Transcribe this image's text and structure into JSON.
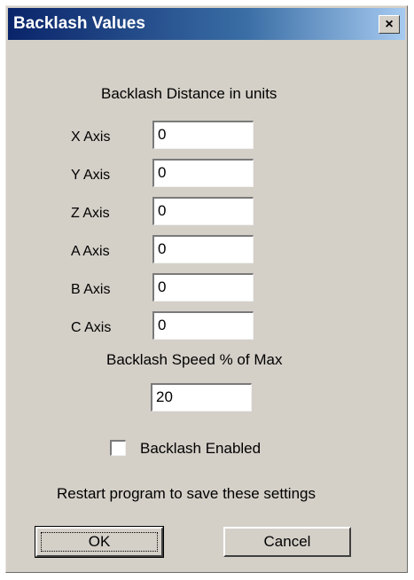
{
  "window": {
    "title": "Backlash Values",
    "close_label": "×"
  },
  "distance_heading": "Backlash Distance in units",
  "axes": [
    {
      "label": "X Axis",
      "value": "0"
    },
    {
      "label": "Y Axis",
      "value": "0"
    },
    {
      "label": "Z Axis",
      "value": "0"
    },
    {
      "label": "A Axis",
      "value": "0"
    },
    {
      "label": "B Axis",
      "value": "0"
    },
    {
      "label": "C Axis",
      "value": "0"
    }
  ],
  "speed_label": "Backlash Speed % of Max",
  "speed_value": "20",
  "enabled_label": "Backlash Enabled",
  "enabled_checked": false,
  "restart_note": "Restart program to save these settings",
  "buttons": {
    "ok": "OK",
    "cancel": "Cancel"
  }
}
